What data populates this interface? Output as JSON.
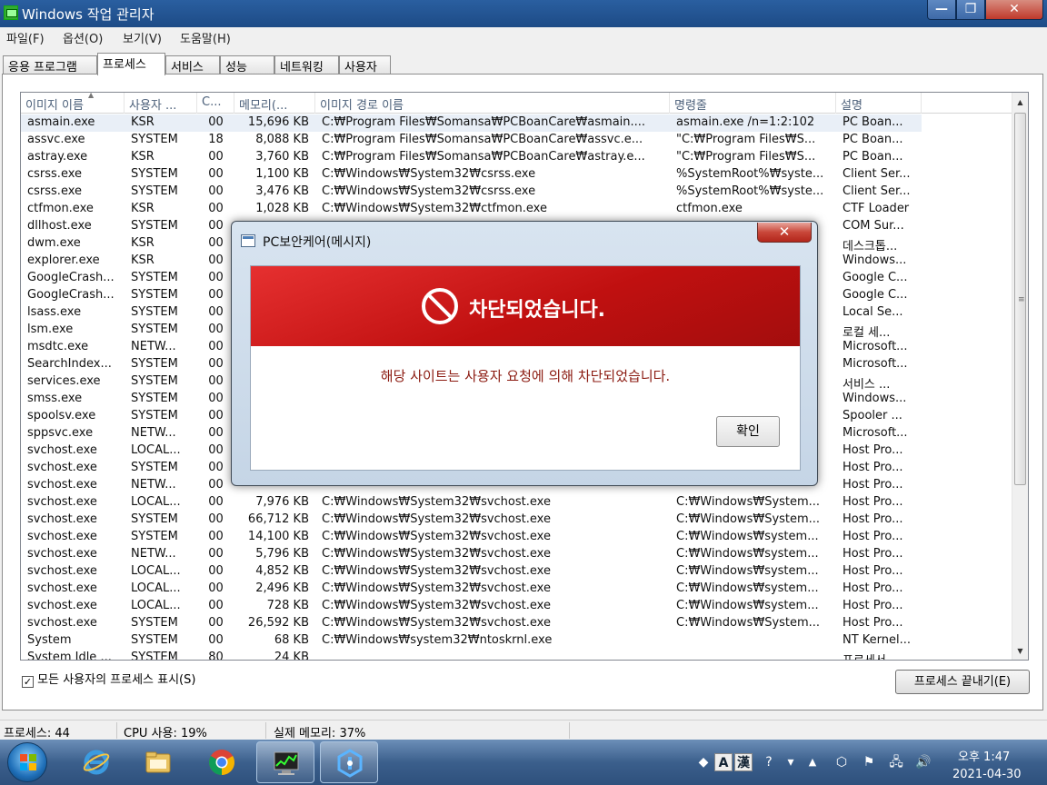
{
  "window": {
    "title": "Windows 작업 관리자"
  },
  "menu": [
    "파일(F)",
    "옵션(O)",
    "보기(V)",
    "도움말(H)"
  ],
  "tabs": [
    "응용 프로그램",
    "프로세스",
    "서비스",
    "성능",
    "네트워킹",
    "사용자"
  ],
  "active_tab": "프로세스",
  "columns": [
    "이미지 이름",
    "사용자 ...",
    "C...",
    "메모리(...",
    "이미지 경로 이름",
    "명령줄",
    "설명"
  ],
  "processes": [
    [
      "asmain.exe",
      "KSR",
      "00",
      "15,696 KB",
      "C:₩Program Files₩Somansa₩PCBoanCare₩asmain....",
      "asmain.exe /n=1:2:102",
      "PC Boan..."
    ],
    [
      "assvc.exe",
      "SYSTEM",
      "18",
      "8,088 KB",
      "C:₩Program Files₩Somansa₩PCBoanCare₩assvc.e...",
      "\"C:₩Program Files₩S...",
      "PC Boan..."
    ],
    [
      "astray.exe",
      "KSR",
      "00",
      "3,760 KB",
      "C:₩Program Files₩Somansa₩PCBoanCare₩astray.e...",
      "\"C:₩Program Files₩S...",
      "PC Boan..."
    ],
    [
      "csrss.exe",
      "SYSTEM",
      "00",
      "1,100 KB",
      "C:₩Windows₩System32₩csrss.exe",
      "%SystemRoot%₩syste...",
      "Client Ser..."
    ],
    [
      "csrss.exe",
      "SYSTEM",
      "00",
      "3,476 KB",
      "C:₩Windows₩System32₩csrss.exe",
      "%SystemRoot%₩syste...",
      "Client Ser..."
    ],
    [
      "ctfmon.exe",
      "KSR",
      "00",
      "1,028 KB",
      "C:₩Windows₩System32₩ctfmon.exe",
      "ctfmon.exe",
      "CTF Loader"
    ],
    [
      "dllhost.exe",
      "SYSTEM",
      "00",
      "",
      "",
      "",
      "COM Sur..."
    ],
    [
      "dwm.exe",
      "KSR",
      "00",
      "",
      "",
      "",
      "데스크톱..."
    ],
    [
      "explorer.exe",
      "KSR",
      "00",
      "",
      "",
      "",
      "Windows..."
    ],
    [
      "GoogleCrash...",
      "SYSTEM",
      "00",
      "",
      "",
      "",
      "Google C..."
    ],
    [
      "GoogleCrash...",
      "SYSTEM",
      "00",
      "",
      "",
      "",
      "Google C..."
    ],
    [
      "lsass.exe",
      "SYSTEM",
      "00",
      "",
      "",
      "",
      "Local Se..."
    ],
    [
      "lsm.exe",
      "SYSTEM",
      "00",
      "",
      "",
      "",
      "로컬 세..."
    ],
    [
      "msdtc.exe",
      "NETW...",
      "00",
      "",
      "",
      "",
      "Microsoft..."
    ],
    [
      "SearchIndex...",
      "SYSTEM",
      "00",
      "",
      "",
      "",
      "Microsoft..."
    ],
    [
      "services.exe",
      "SYSTEM",
      "00",
      "",
      "",
      "",
      "서비스 ..."
    ],
    [
      "smss.exe",
      "SYSTEM",
      "00",
      "",
      "",
      "",
      "Windows..."
    ],
    [
      "spoolsv.exe",
      "SYSTEM",
      "00",
      "",
      "",
      "",
      "Spooler ..."
    ],
    [
      "sppsvc.exe",
      "NETW...",
      "00",
      "",
      "",
      "",
      "Microsoft..."
    ],
    [
      "svchost.exe",
      "LOCAL...",
      "00",
      "",
      "",
      "",
      "Host Pro..."
    ],
    [
      "svchost.exe",
      "SYSTEM",
      "00",
      "",
      "",
      "",
      "Host Pro..."
    ],
    [
      "svchost.exe",
      "NETW...",
      "00",
      "",
      "",
      "",
      "Host Pro..."
    ],
    [
      "svchost.exe",
      "LOCAL...",
      "00",
      "7,976 KB",
      "C:₩Windows₩System32₩svchost.exe",
      "C:₩Windows₩System...",
      "Host Pro..."
    ],
    [
      "svchost.exe",
      "SYSTEM",
      "00",
      "66,712 KB",
      "C:₩Windows₩System32₩svchost.exe",
      "C:₩Windows₩System...",
      "Host Pro..."
    ],
    [
      "svchost.exe",
      "SYSTEM",
      "00",
      "14,100 KB",
      "C:₩Windows₩System32₩svchost.exe",
      "C:₩Windows₩system...",
      "Host Pro..."
    ],
    [
      "svchost.exe",
      "NETW...",
      "00",
      "5,796 KB",
      "C:₩Windows₩System32₩svchost.exe",
      "C:₩Windows₩system...",
      "Host Pro..."
    ],
    [
      "svchost.exe",
      "LOCAL...",
      "00",
      "4,852 KB",
      "C:₩Windows₩System32₩svchost.exe",
      "C:₩Windows₩system...",
      "Host Pro..."
    ],
    [
      "svchost.exe",
      "LOCAL...",
      "00",
      "2,496 KB",
      "C:₩Windows₩System32₩svchost.exe",
      "C:₩Windows₩system...",
      "Host Pro..."
    ],
    [
      "svchost.exe",
      "LOCAL...",
      "00",
      "728 KB",
      "C:₩Windows₩System32₩svchost.exe",
      "C:₩Windows₩system...",
      "Host Pro..."
    ],
    [
      "svchost.exe",
      "SYSTEM",
      "00",
      "26,592 KB",
      "C:₩Windows₩System32₩svchost.exe",
      "C:₩Windows₩System...",
      "Host Pro..."
    ],
    [
      "System",
      "SYSTEM",
      "00",
      "68 KB",
      "C:₩Windows₩system32₩ntoskrnl.exe",
      "",
      "NT Kernel..."
    ],
    [
      "System Idle ...",
      "SYSTEM",
      "80",
      "24 KB",
      "",
      "",
      "프로세서..."
    ]
  ],
  "show_all_label": "모든 사용자의 프로세스 표시(S)",
  "show_all_checked": true,
  "end_process_label": "프로세스 끝내기(E)",
  "status": {
    "processes": "프로세스: 44",
    "cpu": "CPU 사용: 19%",
    "memory": "실제 메모리: 37%"
  },
  "dialog": {
    "title": "PC보안케어(메시지)",
    "heading": "차단되었습니다.",
    "message": "해당 사이트는 사용자 요청에 의해 차단되었습니다.",
    "confirm_label": "확인",
    "banner_color": "#d81f1f"
  },
  "tray": {
    "time": "오후 1:47",
    "date": "2021-04-30",
    "ime": [
      "A",
      "漢"
    ]
  },
  "taskbar_apps": [
    "internet-explorer-icon",
    "file-explorer-icon",
    "chrome-icon",
    "task-manager-icon",
    "pc-boancare-icon"
  ]
}
